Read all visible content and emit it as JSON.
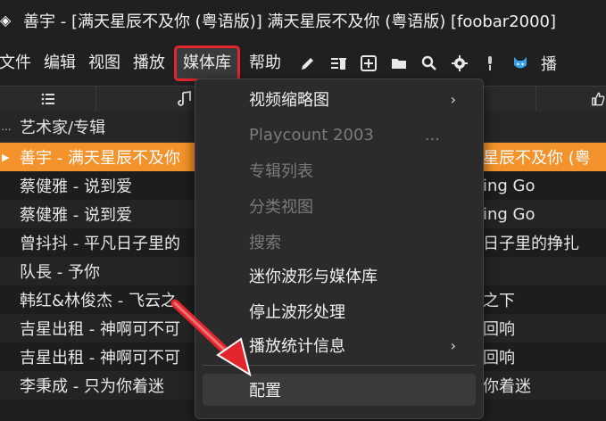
{
  "window": {
    "title": "善宇 - [满天星辰不及你 (粤语版)] 满天星辰不及你 (粤语版)  [foobar2000]"
  },
  "menubar": {
    "items": [
      "文件",
      "编辑",
      "视图",
      "播放",
      "媒体库",
      "帮助"
    ],
    "active_index": 4,
    "tail_text": "播"
  },
  "toolbar": {
    "icons": [
      "pencil-icon",
      "delete-list-icon",
      "add-icon",
      "folder-icon",
      "search-icon",
      "gear-icon",
      "microphone-icon",
      "cat-mascot-icon"
    ]
  },
  "columns": {
    "header": "艺术家/专辑",
    "dots": "..."
  },
  "rows": [
    {
      "left": "善宇 - 满天星辰不及你",
      "right": "星辰不及你 (粤",
      "selected": true
    },
    {
      "left": "蔡健雅 - 说到爱",
      "right": "ing Go",
      "selected": false
    },
    {
      "left": "蔡健雅 - 说到爱",
      "right": "ing Go",
      "selected": false
    },
    {
      "left": "曾抖抖 - 平凡日子里的",
      "right": "日子里的挣扎",
      "selected": false
    },
    {
      "left": "队長 - 予你",
      "right": "",
      "selected": false
    },
    {
      "left": "韩红&林俊杰 - 飞云之",
      "right": "之下",
      "selected": false
    },
    {
      "left": "吉星出租 - 神啊可不可",
      "right": "回响",
      "selected": false
    },
    {
      "left": "吉星出租 - 神啊可不可",
      "right": "回响",
      "selected": false
    },
    {
      "left": "李秉成 - 只为你着迷",
      "right": "你着迷",
      "selected": false
    }
  ],
  "context_menu": {
    "items": [
      {
        "label": "视频缩略图",
        "disabled": false,
        "submenu": true,
        "shortcut": ""
      },
      {
        "label": "Playcount 2003",
        "disabled": true,
        "submenu": false,
        "shortcut": "..."
      },
      {
        "label": "专辑列表",
        "disabled": true,
        "submenu": false,
        "shortcut": ""
      },
      {
        "label": "分类视图",
        "disabled": true,
        "submenu": false,
        "shortcut": ""
      },
      {
        "label": "搜索",
        "disabled": true,
        "submenu": false,
        "shortcut": ""
      },
      {
        "label": "迷你波形与媒体库",
        "disabled": false,
        "submenu": false,
        "shortcut": ""
      },
      {
        "label": "停止波形处理",
        "disabled": false,
        "submenu": false,
        "shortcut": ""
      },
      {
        "label": "播放统计信息",
        "disabled": false,
        "submenu": true,
        "shortcut": ""
      },
      {
        "label": "配置",
        "disabled": false,
        "submenu": false,
        "shortcut": ""
      }
    ]
  },
  "colors": {
    "selection": "#f4922b",
    "highlight_box": "#e3262d",
    "annotation_arrow": "#e3262d"
  }
}
